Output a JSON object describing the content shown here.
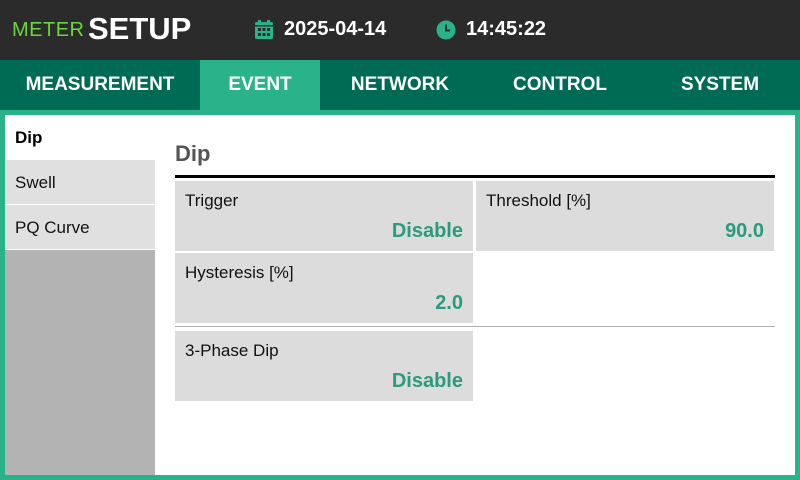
{
  "header": {
    "title_small": "METER",
    "title_big": "SETUP",
    "date": "2025-04-14",
    "time": "14:45:22",
    "date_icon": "calendar-icon",
    "time_icon": "clock-icon"
  },
  "tabs": [
    {
      "label": "MEASUREMENT",
      "active": false
    },
    {
      "label": "EVENT",
      "active": true
    },
    {
      "label": "NETWORK",
      "active": false
    },
    {
      "label": "CONTROL",
      "active": false
    },
    {
      "label": "SYSTEM",
      "active": false
    }
  ],
  "sidebar": {
    "items": [
      {
        "label": "Dip",
        "active": true
      },
      {
        "label": "Swell",
        "active": false
      },
      {
        "label": "PQ Curve",
        "active": false
      }
    ]
  },
  "main": {
    "title": "Dip",
    "fields": {
      "trigger": {
        "label": "Trigger",
        "value": "Disable"
      },
      "threshold": {
        "label": "Threshold [%]",
        "value": "90.0"
      },
      "hysteresis": {
        "label": "Hysteresis [%]",
        "value": "2.0"
      },
      "three_phase_dip": {
        "label": "3-Phase Dip",
        "value": "Disable"
      }
    }
  },
  "colors": {
    "accent": "#2ab38a",
    "tab_bar": "#006b54",
    "value_text": "#2a9b7f",
    "title_green": "#6bd63b",
    "topbar": "#2b2b2b"
  }
}
